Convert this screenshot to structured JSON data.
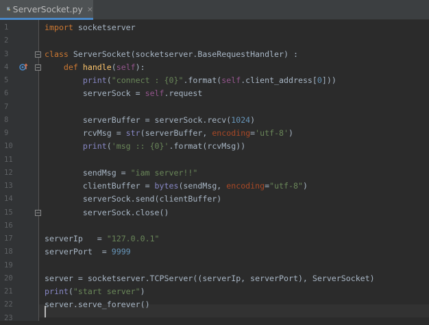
{
  "tab": {
    "filename": "ServerSocket.py",
    "close_glyph": "×"
  },
  "line_numbers": [
    "1",
    "2",
    "3",
    "4",
    "5",
    "6",
    "7",
    "8",
    "9",
    "10",
    "11",
    "12",
    "13",
    "14",
    "15",
    "16",
    "17",
    "18",
    "19",
    "20",
    "21",
    "22",
    "23"
  ],
  "code": {
    "l1": {
      "import_kw": "import",
      "module": " socketserver"
    },
    "l3": {
      "class_kw": "class",
      "decl": " ServerSocket(socketserver.BaseRequestHandler) :"
    },
    "l4": {
      "indent": "    ",
      "def_kw": "def",
      "sp": " ",
      "func": "handle",
      "open": "(",
      "self": "self",
      "close": "):"
    },
    "l5": {
      "indent": "        ",
      "print": "print",
      "open": "(",
      "str": "\"connect : {0}\"",
      "mid": ".format(",
      "self": "self",
      "tail": ".client_address[",
      "num": "0",
      "end": "]))"
    },
    "l6": {
      "indent": "        ",
      "lhs": "serverSock = ",
      "self": "self",
      "tail": ".request"
    },
    "l8": {
      "indent": "        ",
      "pre": "serverBuffer = serverSock.recv(",
      "num": "1024",
      "end": ")"
    },
    "l9": {
      "indent": "        ",
      "pre": "rcvMsg = ",
      "str_fn": "str",
      "mid": "(serverBuffer, ",
      "kwarg": "encoding",
      "eq": "=",
      "str": "'utf-8'",
      "end": ")"
    },
    "l10": {
      "indent": "        ",
      "print": "print",
      "open": "(",
      "str": "'msg :: {0}'",
      "end": ".format(rcvMsg))"
    },
    "l12": {
      "indent": "        ",
      "pre": "sendMsg = ",
      "str": "\"iam server!!\""
    },
    "l13": {
      "indent": "        ",
      "pre": "clientBuffer = ",
      "bytes": "bytes",
      "mid": "(sendMsg, ",
      "kwarg": "encoding",
      "eq": "=",
      "str": "\"utf-8\"",
      "end": ")"
    },
    "l14": {
      "text": "        serverSock.send(clientBuffer)"
    },
    "l15": {
      "text": "        serverSock.close()"
    },
    "l17": {
      "pre": "serverIp   = ",
      "str": "\"127.0.0.1\""
    },
    "l18": {
      "pre": "serverPort  = ",
      "num": "9999"
    },
    "l20": {
      "text": "server = socketserver.TCPServer((serverIp, serverPort), ServerSocket)"
    },
    "l21": {
      "print": "print",
      "open": "(",
      "str": "\"start server\"",
      "end": ")"
    },
    "l22": {
      "text": "server.serve_forever()"
    }
  },
  "icons": {
    "tab": "python-file-icon",
    "override": "override-method-icon",
    "fold": "fold-marker-icon"
  },
  "colors": {
    "background": "#2b2b2b",
    "gutter": "#313335",
    "keyword": "#cc7832",
    "string": "#6a8759",
    "number": "#6897bb",
    "self": "#94558d",
    "function_name": "#ffc66d",
    "builtin": "#8888c6",
    "kwarg": "#aa4926",
    "text": "#a9b7c6",
    "line_number": "#606366",
    "tab_underline": "#4a88c7"
  }
}
